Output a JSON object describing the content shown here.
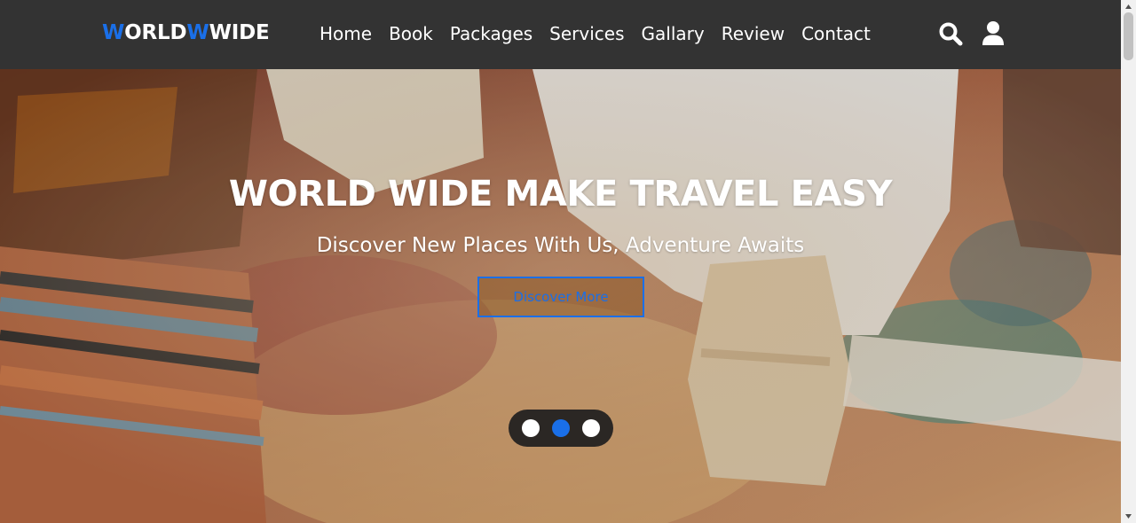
{
  "brand": {
    "part1": "W",
    "part2": "ORLD",
    "part3": "W",
    "part4": "WIDE",
    "accent": "#1a6fe8"
  },
  "nav": {
    "links": [
      "Home",
      "Book",
      "Packages",
      "Services",
      "Gallary",
      "Review",
      "Contact"
    ],
    "icons": [
      "search-icon",
      "user-icon"
    ]
  },
  "hero": {
    "title": "WORLD WIDE MAKE TRAVEL EASY",
    "subtitle": "Discover New Places With Us, Adventure Awaits",
    "button": "Discover More",
    "slides": {
      "count": 3,
      "active": 2
    }
  },
  "colors": {
    "navbar": "#333333",
    "accent": "#1a6fe8",
    "text": "#ffffff"
  }
}
